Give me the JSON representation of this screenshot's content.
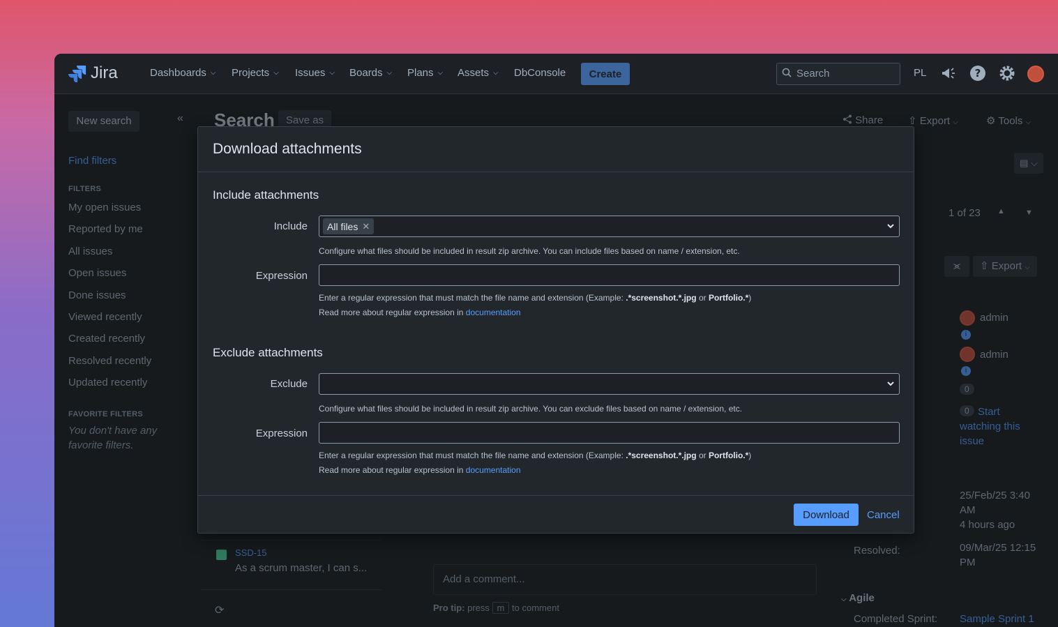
{
  "nav": {
    "logo": "Jira",
    "items": [
      "Dashboards",
      "Projects",
      "Issues",
      "Boards",
      "Plans",
      "Assets"
    ],
    "dbconsole": "DbConsole",
    "create": "Create",
    "search_placeholder": "Search",
    "initials": "PL"
  },
  "sidebar": {
    "new_search": "New search",
    "find_filters": "Find filters",
    "filters_heading": "FILTERS",
    "filters": [
      "My open issues",
      "Reported by me",
      "All issues",
      "Open issues",
      "Done issues",
      "Viewed recently",
      "Created recently",
      "Resolved recently",
      "Updated recently"
    ],
    "favorite_heading": "FAVORITE FILTERS",
    "favorite_empty": "You don't have any favorite filters."
  },
  "main": {
    "title": "Search",
    "save_as": "Save as",
    "share": "Share",
    "export": "Export",
    "tools": "Tools",
    "pager": "1 of 23",
    "issue_export": "Export",
    "people": [
      "admin",
      "admin"
    ],
    "votes": "0",
    "watchers": "0",
    "watch_link": "Start watching this issue",
    "created_date": "25/Feb/25 3:40 AM",
    "updated_rel": "4 hours ago",
    "resolved_label": "Resolved:",
    "resolved_date": "09/Mar/25 12:15 PM",
    "agile_heading": "Agile",
    "sprint_label": "Completed Sprint:",
    "sprint_value": "Sample Sprint 1",
    "issue_key": "SSD-15",
    "issue_summary": "As a scrum master, I can s...",
    "comment_placeholder": "Add a comment...",
    "protip_bold": "Pro tip:",
    "protip_press": "press",
    "protip_key": "m",
    "protip_rest": "to comment"
  },
  "modal": {
    "title": "Download attachments",
    "include_heading": "Include attachments",
    "include_label": "Include",
    "include_tag": "All files",
    "include_help": "Configure what files should be included in result zip archive. You can include files based on name / extension, etc.",
    "expression_label": "Expression",
    "regex_help_pre": "Enter a regular expression that must match the file name and extension (Example: ",
    "regex_ex1": ".*screenshot.*.jpg",
    "regex_or": " or ",
    "regex_ex2": "Portfolio.*",
    "regex_post": ")",
    "doc_pre": "Read more about regular expression in ",
    "doc_link": "documentation",
    "exclude_heading": "Exclude attachments",
    "exclude_label": "Exclude",
    "exclude_help": "Configure what files should be included in result zip archive. You can exclude files based on name / extension, etc.",
    "download": "Download",
    "cancel": "Cancel"
  }
}
